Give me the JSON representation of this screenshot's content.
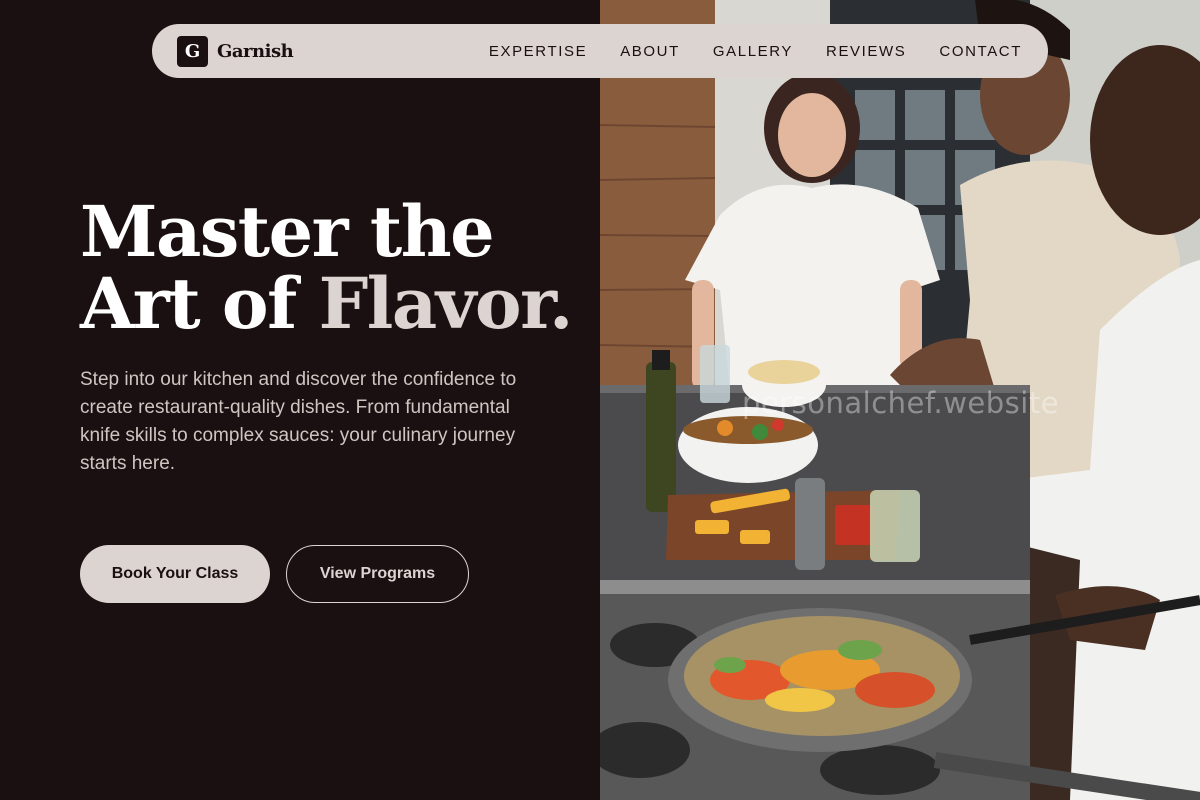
{
  "brand": {
    "logo_letter": "G",
    "name": "Garnish"
  },
  "nav": {
    "links": [
      {
        "label": "EXPERTISE"
      },
      {
        "label": "ABOUT"
      },
      {
        "label": "GALLERY"
      },
      {
        "label": "REVIEWS"
      },
      {
        "label": "CONTACT"
      }
    ]
  },
  "hero": {
    "headline_line1": "Master the",
    "headline_line2_start": "Art of ",
    "headline_line2_accent": "Flavor.",
    "subtext": "Step into our kitchen and discover the confidence to create restaurant-quality dishes. From fundamental knife skills to complex sauces: your culinary journey starts here.",
    "primary_cta": "Book Your Class",
    "secondary_cta": "View Programs"
  },
  "photo": {
    "alt": "",
    "watermark": "personalchef.website"
  },
  "colors": {
    "background": "#1a1011",
    "accent": "#dcd4d1",
    "text_primary": "#ffffff",
    "text_muted": "#cfc5c1"
  }
}
